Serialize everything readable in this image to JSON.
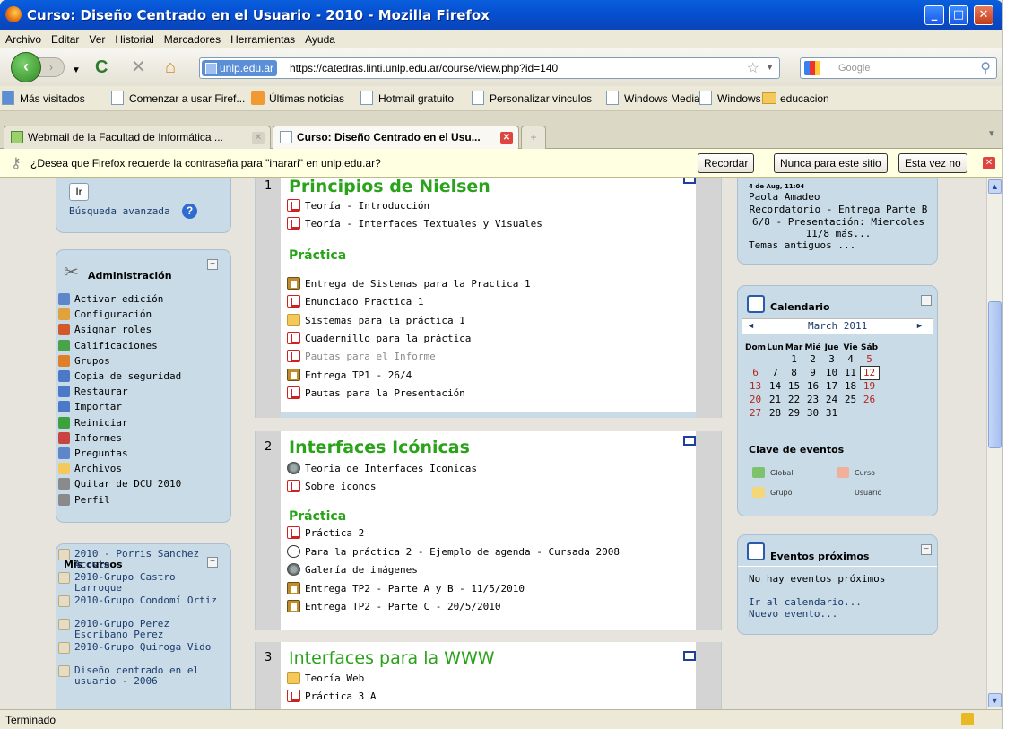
{
  "window": {
    "title": "Curso: Diseño Centrado en el Usuario - 2010 - Mozilla Firefox",
    "min": "_",
    "max": "□",
    "close": "✕"
  },
  "menu": [
    "Archivo",
    "Editar",
    "Ver",
    "Historial",
    "Marcadores",
    "Herramientas",
    "Ayuda"
  ],
  "nav": {
    "site_label": "unlp.edu.ar",
    "url": "https://catedras.linti.unlp.edu.ar/course/view.php?id=140",
    "search_placeholder": "Google"
  },
  "bookmarks": [
    "Más visitados",
    "Comenzar a usar Firef...",
    "Últimas noticias",
    "Hotmail gratuito",
    "Personalizar vínculos",
    "Windows Media",
    "Windows",
    "educacion"
  ],
  "tabs": [
    {
      "label": "Webmail de la Facultad de Informática ..."
    },
    {
      "label": "Curso: Diseño Centrado en el Usu..."
    }
  ],
  "notification": {
    "message": "¿Desea que Firefox recuerde la contraseña para \"iharari\" en unlp.edu.ar?",
    "remember": "Recordar",
    "never": "Nunca para este sitio",
    "not_now": "Esta vez no"
  },
  "search_block": {
    "go": "Ir",
    "advanced": "Búsqueda avanzada"
  },
  "admin": {
    "title": "Administración",
    "items": [
      "Activar edición",
      "Configuración",
      "Asignar roles",
      "Calificaciones",
      "Grupos",
      "Copia de seguridad",
      "Restaurar",
      "Importar",
      "Reiniciar",
      "Informes",
      "Preguntas",
      "Archivos",
      "Quitar de DCU 2010",
      "Perfil"
    ]
  },
  "mycourses": {
    "title": "Mis cursos",
    "items": [
      "2010 - Porris Sanchez Acosta",
      "2010-Grupo Castro Larroque",
      "2010-Grupo Condomí Ortiz",
      "2010-Grupo Perez Escribano Perez",
      "2010-Grupo Quiroga Vido",
      "Diseño centrado en el usuario - 2006"
    ]
  },
  "sections": [
    {
      "num": "1",
      "title": "Principios de Nielsen",
      "items": [
        "Teoría - Introducción",
        "Teoría - Interfaces Textuales y Visuales"
      ],
      "practica": "Práctica",
      "practice_items": [
        "Entrega de Sistemas para la Practica 1",
        "Enunciado Practica 1",
        "Sistemas para la práctica 1",
        "Cuadernillo para la práctica",
        "Pautas para el Informe",
        "Entrega TP1 - 26/4",
        "Pautas para la Presentación"
      ]
    },
    {
      "num": "2",
      "title": "Interfaces Icónicas",
      "items": [
        "Teoria de Interfaces Iconicas",
        "Sobre íconos"
      ],
      "practica": "Práctica",
      "practice_items": [
        "Práctica 2",
        "Para la práctica 2 - Ejemplo de agenda - Cursada 2008",
        "Galería de imágenes",
        "Entrega TP2 - Parte A y B - 11/5/2010",
        "Entrega TP2 - Parte C - 20/5/2010"
      ]
    },
    {
      "num": "3",
      "title": "Interfaces para la WWW",
      "items": [
        "Teoría Web",
        "Práctica 3 A"
      ]
    }
  ],
  "news": {
    "date": "4 de Aug, 11:04",
    "author": "Paola Amadeo",
    "text": [
      "Recordatorio - Entrega Parte B",
      "6/8 - Presentación: Miercoles",
      "11/8 más..."
    ],
    "older": "Temas antiguos ..."
  },
  "calendar": {
    "title": "Calendario",
    "month": "March 2011",
    "days": [
      "Dom",
      "Lun",
      "Mar",
      "Mié",
      "Jue",
      "Vie",
      "Sáb"
    ],
    "weeks": [
      [
        "",
        "",
        "1",
        "2",
        "3",
        "4",
        "5"
      ],
      [
        "6",
        "7",
        "8",
        "9",
        "10",
        "11",
        "12"
      ],
      [
        "13",
        "14",
        "15",
        "16",
        "17",
        "18",
        "19"
      ],
      [
        "20",
        "21",
        "22",
        "23",
        "24",
        "25",
        "26"
      ],
      [
        "27",
        "28",
        "29",
        "30",
        "31",
        "",
        ""
      ]
    ],
    "today": "12",
    "events_key": "Clave de eventos",
    "keys": [
      "Global",
      "Curso",
      "Grupo",
      "Usuario"
    ]
  },
  "upcoming": {
    "title": "Eventos próximos",
    "none": "No hay eventos próximos",
    "goto": "Ir al calendario...",
    "new": "Nuevo evento..."
  },
  "status": "Terminado"
}
